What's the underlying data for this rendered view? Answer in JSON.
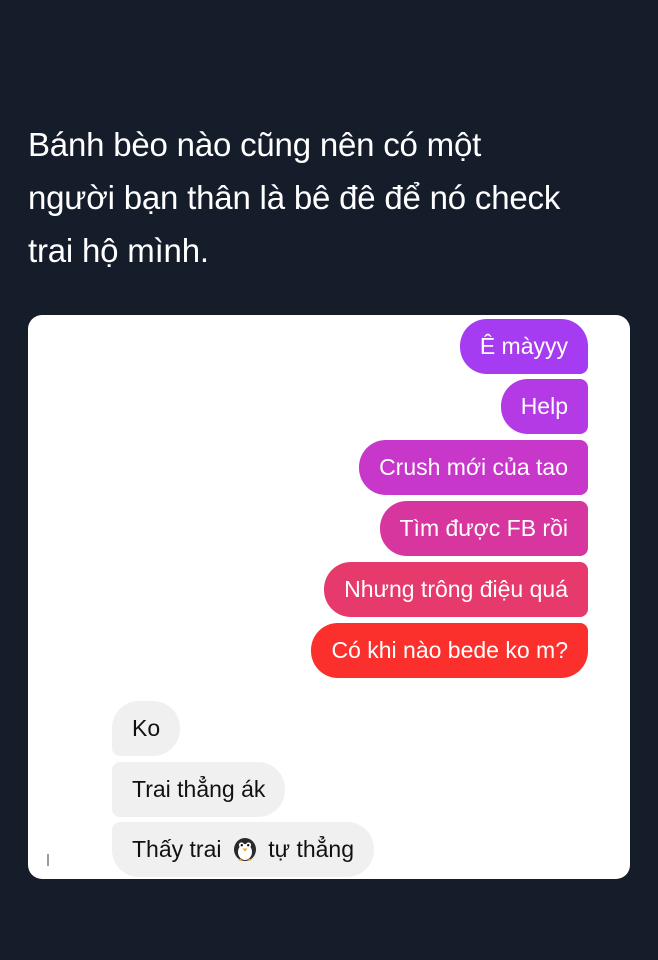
{
  "caption": {
    "line1": "Bánh bèo nào cũng nên có một",
    "line2": "người bạn thân là bê đê để nó check",
    "line3": "trai hộ mình."
  },
  "conversation": {
    "sent": [
      "Ê màyyy",
      "Help",
      "Crush mới của tao",
      "Tìm được FB rồi",
      "Nhưng trông điệu quá",
      "Có khi nào bede ko m?"
    ],
    "received": {
      "m1": "Ko",
      "m2": "Trai thẳng ák",
      "m3_before": "Thấy trai",
      "m3_emoji": "penguin-emoji",
      "m3_after": "tự thẳng"
    }
  },
  "colors": {
    "background": "#151d2b",
    "sent_gradient": [
      "#a43bf0",
      "#c936c8",
      "#e0358b",
      "#ef3c52",
      "#fc2f2a"
    ],
    "received_bubble": "#f1f0f0"
  }
}
